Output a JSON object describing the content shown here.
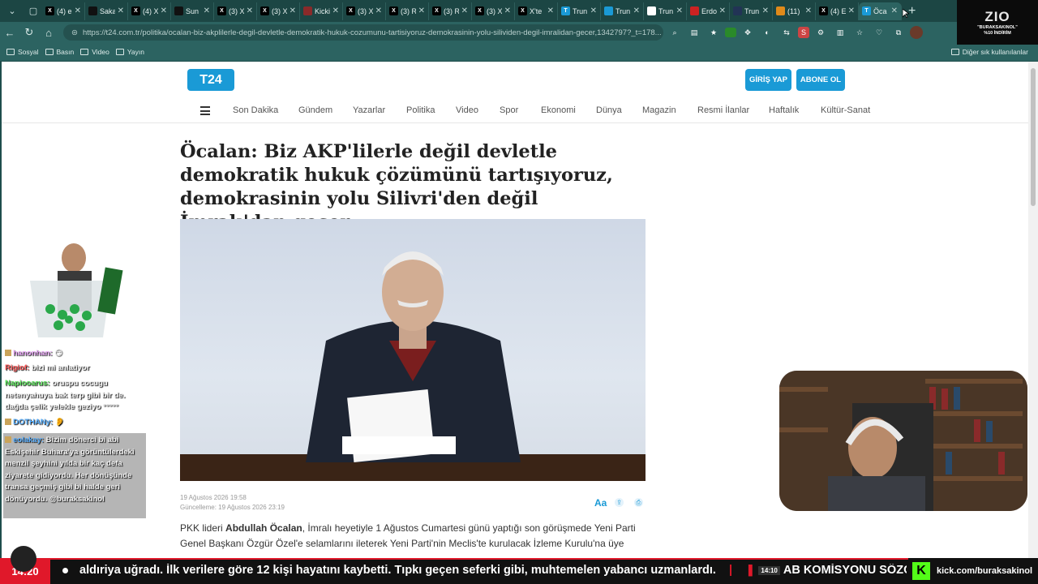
{
  "tabs": [
    {
      "icon": "x-icon",
      "label": "(4) el",
      "color": "#000000"
    },
    {
      "icon": "news-icon",
      "label": "Saka",
      "color": "#111111"
    },
    {
      "icon": "x-icon",
      "label": "(4) X",
      "color": "#000000"
    },
    {
      "icon": "news-icon",
      "label": "Sun",
      "color": "#111111"
    },
    {
      "icon": "x-icon",
      "label": "(3) X",
      "color": "#000000"
    },
    {
      "icon": "x-icon",
      "label": "(3) X",
      "color": "#000000"
    },
    {
      "icon": "kick-icon",
      "label": "Kicki",
      "color": "#8a2a2a"
    },
    {
      "icon": "x-icon",
      "label": "(3) X",
      "color": "#000000"
    },
    {
      "icon": "x-icon",
      "label": "(3) R",
      "color": "#000000"
    },
    {
      "icon": "x-icon",
      "label": "(3) R",
      "color": "#000000"
    },
    {
      "icon": "x-icon",
      "label": "(3) X",
      "color": "#000000"
    },
    {
      "icon": "x-icon",
      "label": "X'te",
      "color": "#000000"
    },
    {
      "icon": "t24-icon",
      "label": "Trun",
      "color": "#1a9ad6"
    },
    {
      "icon": "circle-icon",
      "label": "Trun",
      "color": "#1a9ad6"
    },
    {
      "icon": "news-icon",
      "label": "Trun",
      "color": "#ffffff"
    },
    {
      "icon": "b-icon",
      "label": "Erdo",
      "color": "#cc2222"
    },
    {
      "icon": "news-icon",
      "label": "Trun",
      "color": "#223355"
    },
    {
      "icon": "news-icon",
      "label": "(11)",
      "color": "#e08a1a"
    },
    {
      "icon": "x-icon",
      "label": "(4) E",
      "color": "#000000"
    },
    {
      "icon": "t24-icon",
      "label": "Öca",
      "color": "#1a9ad6"
    }
  ],
  "browser": {
    "url": "https://t24.com.tr/politika/ocalan-biz-akplilerle-degil-devletle-demokratik-hukuk-cozumunu-tartisiyoruz-demokrasinin-yolu-silividen-degil-imralidan-gecer,1342797?_t=178..."
  },
  "bookmarks": [
    "Sosyal",
    "Basın",
    "Video",
    "Yayın"
  ],
  "bookmarks_right": "Diğer sık kullanılanlar",
  "site": {
    "logo": "T24",
    "login": "GİRİŞ YAP",
    "subscribe": "ABONE OL",
    "categories": [
      "Son Dakika",
      "Gündem",
      "Yazarlar",
      "Politika",
      "Video",
      "Spor",
      "Ekonomi",
      "Dünya",
      "Magazin",
      "Resmi İlanlar",
      "Haftalık",
      "Kültür-Sanat"
    ]
  },
  "article": {
    "headline": "Öcalan: Biz AKP'lilerle değil devletle demokratik hukuk çözümünü tartışıyoruz, demokrasinin yolu Silivri'den değil İmralı'dan geçer",
    "published": "19 Ağustos 2026 19:58",
    "updated": "Güncelleme: 19 Ağustos 2026 23:19",
    "body_prefix": "PKK lideri ",
    "body_name": "Abdullah Öcalan",
    "body_rest": ", İmralı heyetiyle 1 Ağustos Cumartesi günü yaptığı son görüşmede Yeni Parti Genel Başkanı Özgür Özel'e selamlarını ileterek Yeni Parti'nin Meclis'te kurulacak İzleme Kurulu'na üye"
  },
  "chat": [
    {
      "user": "hanonhan:",
      "text": "😏",
      "user_color": "#e6a4f4"
    },
    {
      "user": "Rigiof:",
      "text": "bizi mi anlatiyor",
      "user_color": "#ff5a5a"
    },
    {
      "user": "Napiooarus:",
      "text": "oruspu cocugu netenyahuya bak terp gibi bir de. dağda çelik yelekle geziyo °°°°°",
      "user_color": "#57e157"
    },
    {
      "user": "DOTHANy:",
      "text": "👂",
      "user_color": "#5ab0ff"
    },
    {
      "user": "eolakay:",
      "text": "Bizim dönerci bi abi Eskişehir Buhara'ya görüntülerdeki menzil şeyhini yılda bir kaç defa ziyarete gidiyordu. Her dönüşünde transa geçmiş gibi bi halde geri dönüyordu. @buraksakinol",
      "user_color": "#5ab0ff"
    }
  ],
  "stream": {
    "badge_title": "ZIO",
    "badge_line1": "\"BURAKSAKINOL\"",
    "badge_line2": "%10 İNDİRİM",
    "clock": "14:20",
    "ticker_a": "aldıriya uğradı. İlk verilere göre 12 kişi hayatını kaybetti. Tıpkı geçen seferki gibi, muhtemelen yabancı uzmanlardı.",
    "ticker_sep": "|",
    "ticker_time": "14:10",
    "ticker_b": "AB KOMİSYONU SÖZCÜSÜ: DEN",
    "kick_url": "kick.com/buraksakinol"
  }
}
